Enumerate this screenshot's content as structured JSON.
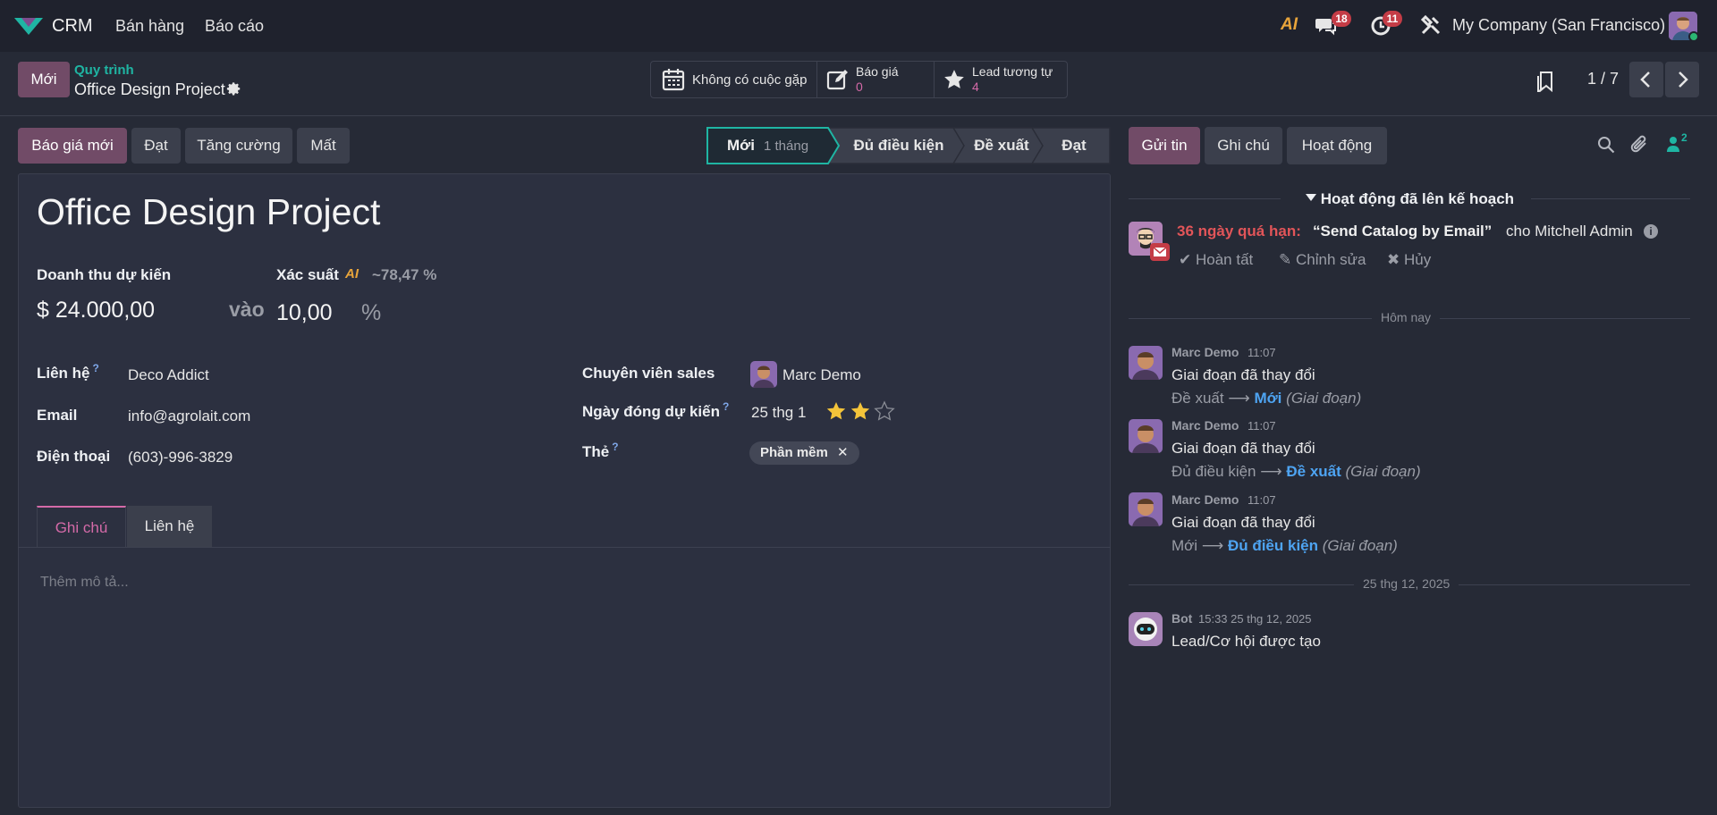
{
  "nav": {
    "app": "CRM",
    "menu": [
      "Bán hàng",
      "Báo cáo"
    ],
    "messages_count": "18",
    "activities_count": "11",
    "company": "My Company (San Francisco)",
    "ai_label": "AI"
  },
  "control": {
    "new_button": "Mới",
    "breadcrumb_parent": "Quy trình",
    "breadcrumb_current": "Office Design Project",
    "stat_meetings": "Không có cuộc gặp",
    "stat_quotes_label": "Báo giá",
    "stat_quotes_value": "0",
    "stat_similar_label": "Lead tương tự",
    "stat_similar_value": "4",
    "pager": "1 / 7"
  },
  "actions": {
    "new_quote": "Báo giá mới",
    "won": "Đạt",
    "enrich": "Tăng cường",
    "lost": "Mất"
  },
  "stages": {
    "current": "Mới",
    "current_duration": "1 tháng",
    "items": [
      "Đủ điều kiện",
      "Đề xuất",
      "Đạt"
    ]
  },
  "form": {
    "title": "Office Design Project",
    "revenue_label": "Doanh thu dự kiến",
    "revenue_value": "$ 24.000,00",
    "at_label": "vào",
    "probability_label": "Xác suất",
    "probability_ai": "~78,47 %",
    "probability_value": "10,00",
    "percent": "%",
    "contact_label": "Liên hệ",
    "contact_value": "Deco Addict",
    "email_label": "Email",
    "email_value": "info@agrolait.com",
    "phone_label": "Điện thoại",
    "phone_value": "(603)-996-3829",
    "salesperson_label": "Chuyên viên sales",
    "salesperson_value": "Marc Demo",
    "deadline_label": "Ngày đóng dự kiến",
    "deadline_value": "25 thg 1",
    "priority_stars": 2,
    "tags_label": "Thẻ",
    "tag": "Phần mềm",
    "help_mark": "?"
  },
  "tabs": {
    "notes": "Ghi chú",
    "contact": "Liên hệ",
    "placeholder": "Thêm mô tả..."
  },
  "chatter": {
    "send": "Gửi tin",
    "log": "Ghi chú",
    "activity": "Hoạt động",
    "followers": "2",
    "planned_header": "Hoạt động đã lên kế hoạch",
    "overdue": "36 ngày quá hạn:",
    "activity_title": "“Send Catalog by Email”",
    "assigned_to": "cho Mitchell Admin",
    "done": "Hoàn tất",
    "edit": "Chỉnh sửa",
    "cancel": "Hủy",
    "today": "Hôm nay",
    "messages": [
      {
        "author": "Marc Demo",
        "time": "11:07",
        "body": "Giai đoạn đã thay đổi",
        "from": "Đề xuất",
        "to": "Mới",
        "field": "(Giai đoạn)"
      },
      {
        "author": "Marc Demo",
        "time": "11:07",
        "body": "Giai đoạn đã thay đổi",
        "from": "Đủ điều kiện",
        "to": "Đề xuất",
        "field": "(Giai đoạn)"
      },
      {
        "author": "Marc Demo",
        "time": "11:07",
        "body": "Giai đoạn đã thay đổi",
        "from": "Mới",
        "to": "Đủ điều kiện",
        "field": "(Giai đoạn)"
      }
    ],
    "date_sep": "25 thg 12, 2025",
    "bot": {
      "author": "Bot",
      "time": "15:33 25 thg 12, 2025",
      "body": "Lead/Cơ hội được tạo"
    }
  },
  "colors": {
    "primary": "#714b67",
    "accent_teal": "#1fb5a3",
    "overdue_red": "#e25559",
    "link_blue": "#4ea4f2",
    "star": "#f4c43a"
  }
}
